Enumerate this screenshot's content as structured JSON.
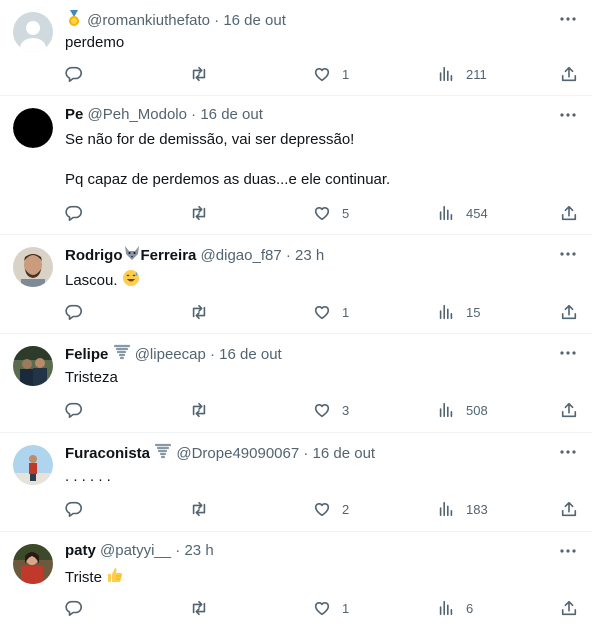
{
  "tweets": [
    {
      "badge": "medal",
      "name": "",
      "handle": "@romankiuthefato",
      "time": "16 de out",
      "text": "perdemo",
      "likes": "1",
      "views": "211",
      "avatar": "default-gray"
    },
    {
      "name": "Pe",
      "handle": "@Peh_Modolo",
      "time": "16 de out",
      "text": "Se não for de demissão, vai ser depressão!\n\nPq capaz de perdemos as duas...e ele continuar.",
      "likes": "5",
      "views": "454",
      "avatar": "black"
    },
    {
      "name": "Rodrigo",
      "name_suffix": "Ferreira",
      "name_emoji": "wolf",
      "handle": "@digao_f87",
      "time": "23 h",
      "text": "Lascou.",
      "text_emoji": "sweat-smile",
      "likes": "1",
      "views": "15",
      "avatar": "man-beard"
    },
    {
      "name": "Felipe",
      "name_emoji": "tornado",
      "handle": "@lipeecap",
      "time": "16 de out",
      "text": "Tristeza",
      "likes": "3",
      "views": "508",
      "avatar": "group-photo"
    },
    {
      "name": "Furaconista",
      "name_emoji": "tornado",
      "handle": "@Drope49090067",
      "time": "16 de out",
      "text": ". . . . . .",
      "likes": "2",
      "views": "183",
      "avatar": "sky-figure"
    },
    {
      "name": "paty",
      "handle": "@patyyi__",
      "time": "23 h",
      "text": "Triste",
      "text_emoji": "thumbs-up",
      "likes": "1",
      "views": "6",
      "avatar": "red-outfit"
    }
  ],
  "colors": {
    "text": "#0f1419",
    "secondary": "#536471",
    "divider": "#eff3f4"
  },
  "icons": [
    "reply-icon",
    "retweet-icon",
    "like-icon",
    "views-icon",
    "share-icon",
    "more-icon"
  ]
}
